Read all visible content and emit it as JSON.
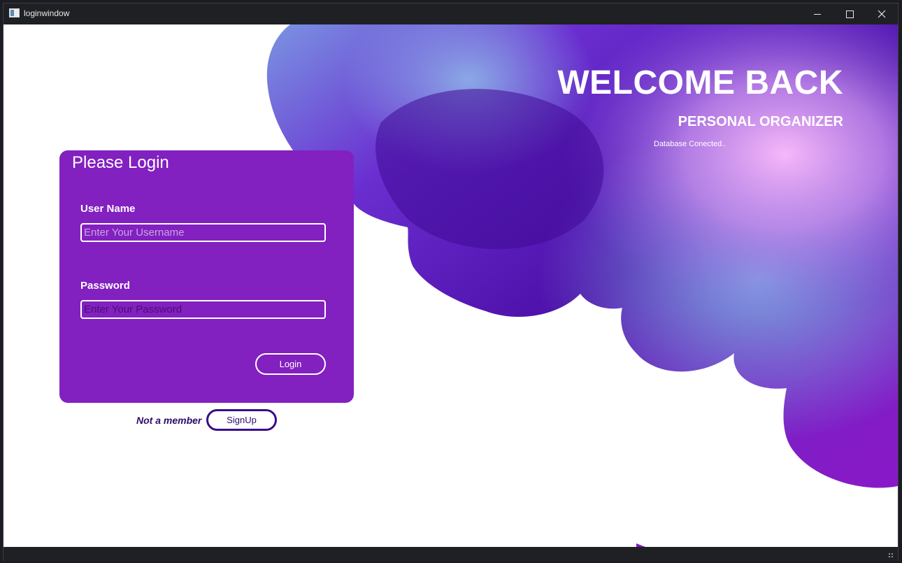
{
  "window": {
    "title": "loginwindow"
  },
  "header": {
    "welcome": "WELCOME BACK",
    "subtitle": "PERSONAL ORGANIZER",
    "db_status": "Database Conected.."
  },
  "login_card": {
    "title": "Please Login",
    "username_label": "User Name",
    "username_placeholder": "Enter Your Username",
    "username_value": "",
    "password_label": "Password",
    "password_placeholder": "Enter Your Password",
    "password_value": "",
    "login_label": "Login"
  },
  "signup": {
    "prompt": "Not a member",
    "button_label": "SignUp"
  },
  "colors": {
    "card": "#8320c0",
    "blob_dark": "#4b0fa0",
    "blob_light": "#7f93e0",
    "blob_pink": "#f4b4f8",
    "signup_accent": "#3a0c8a"
  },
  "icons": {
    "app": "app-window-icon",
    "minimize": "minimize-icon",
    "maximize": "maximize-icon",
    "close": "close-icon"
  }
}
